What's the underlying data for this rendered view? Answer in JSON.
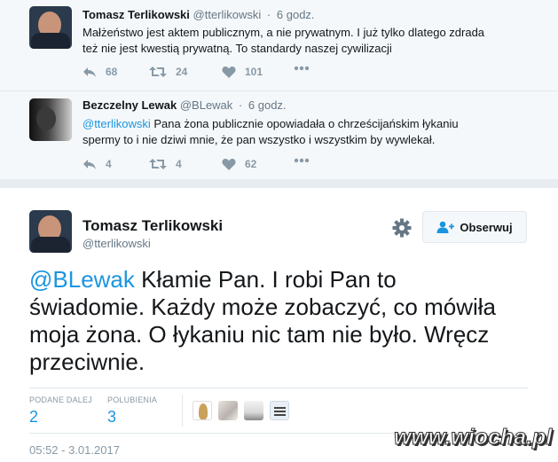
{
  "tweets": [
    {
      "name": "Tomasz Terlikowski",
      "handle": "@tterlikowski",
      "time": "6 godz.",
      "lines": [
        "Małżeństwo jest aktem publicznym, a nie prywatnym. I już tylko dlatego zdrada",
        "też nie jest kwestią prywatną. To standardy naszej cywilizacji"
      ],
      "replies": "68",
      "retweets": "24",
      "likes": "101"
    },
    {
      "name": "Bezczelny Lewak",
      "handle": "@BLewak",
      "time": "6 godz.",
      "mention": "@tterlikowski",
      "line1_rest": " Pana żona publicznie opowiadała o chrześcijańskim łykaniu",
      "line2": "spermy to i nie dziwi mnie, że pan wszystko i wszystkim by wywlekał.",
      "replies": "4",
      "retweets": "4",
      "likes": "62"
    }
  ],
  "main_tweet": {
    "name": "Tomasz Terlikowski",
    "handle": "@tterlikowski",
    "follow_label": "Obserwuj",
    "mention": "@BLewak",
    "line1_rest": " Kłamie Pan. I robi Pan to",
    "line2": "świadomie. Każdy może zobaczyć, co mówiła",
    "line3": "moja żona. O łykaniu nic tam nie było. Wręcz",
    "line4": "przeciwnie.",
    "stats": {
      "retweets_label": "PODANE DALEJ",
      "retweets": "2",
      "likes_label": "POLUBIENIA",
      "likes": "3"
    },
    "timestamp": "05:52 - 3.01.2017"
  },
  "watermark": "www.wiocha.pl",
  "colors": {
    "link": "#1b95e0",
    "muted": "#657786",
    "icon": "#8899a6",
    "thread_bg": "#f5f8fa"
  }
}
